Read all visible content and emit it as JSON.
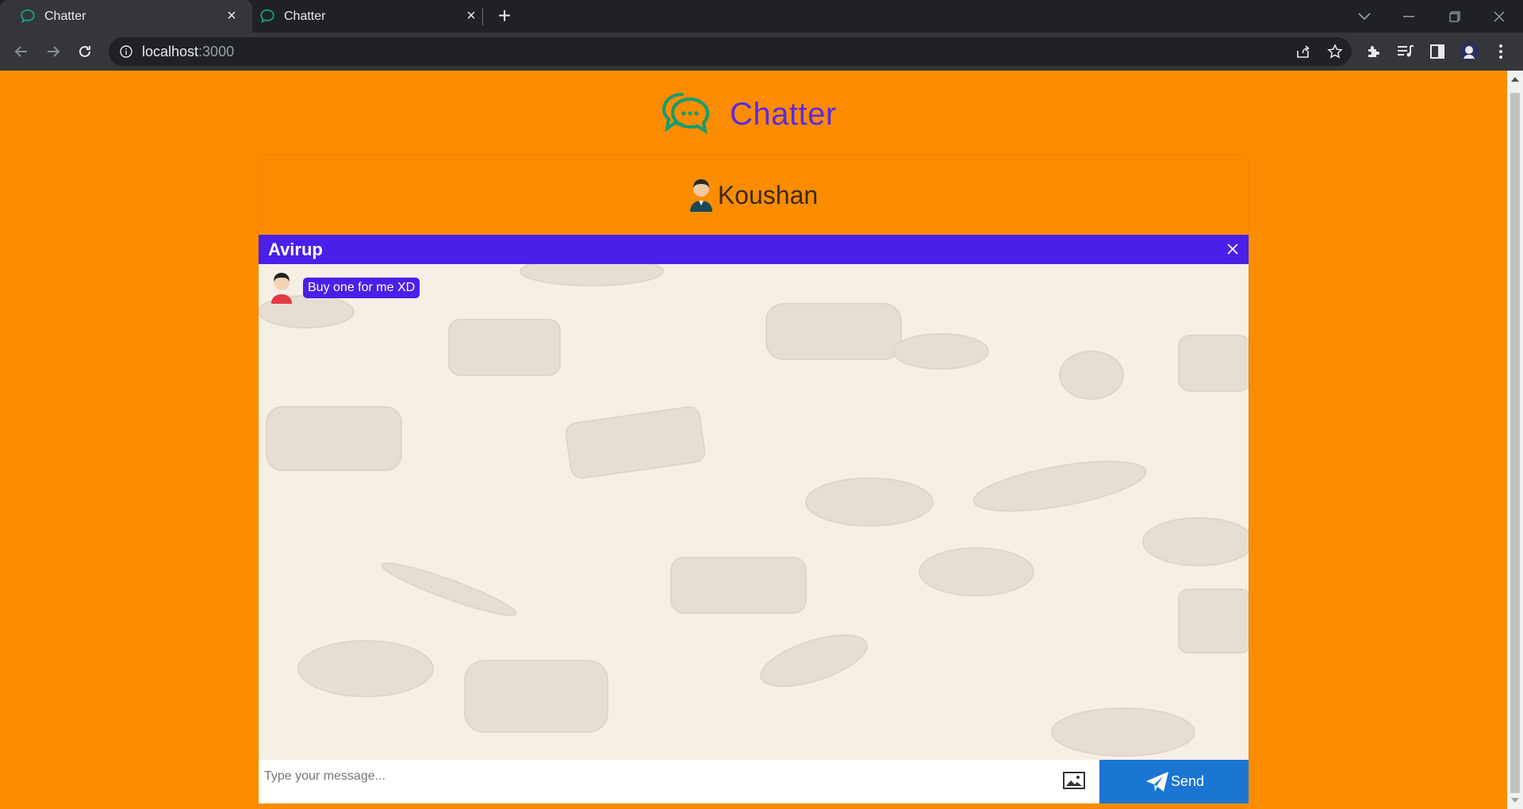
{
  "browser": {
    "tabs": [
      {
        "title": "Chatter",
        "close_label": "×"
      },
      {
        "title": "Chatter",
        "close_label": "×"
      }
    ],
    "new_tab_label": "+",
    "url_host": "localhost",
    "url_port": ":3000"
  },
  "app": {
    "brand_name": "Chatter",
    "current_user": "Koushan"
  },
  "chat": {
    "peer_name": "Avirup",
    "messages": [
      {
        "text": "Buy one for me XD",
        "sender": "Avirup"
      }
    ],
    "input_placeholder": "Type your message...",
    "send_label": "Send"
  },
  "colors": {
    "page_background": "#fb8c00",
    "brand_purple": "#5b2be0",
    "chat_header": "#4a1fe8",
    "send_button": "#1b76d2",
    "logo_green": "#0f9d73"
  }
}
